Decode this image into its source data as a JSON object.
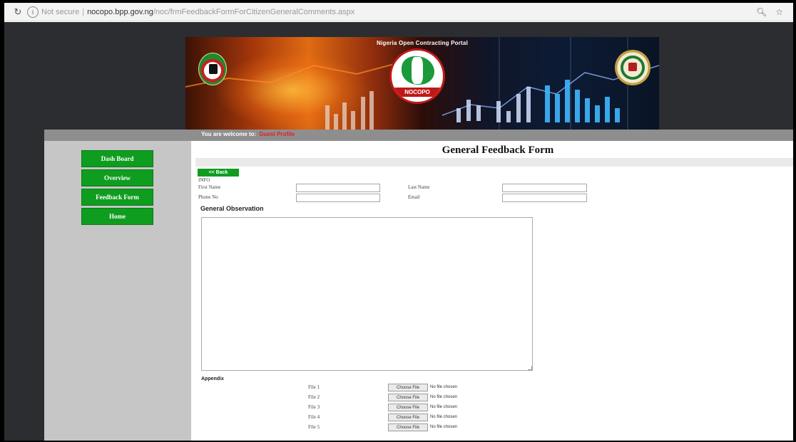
{
  "browser": {
    "security_label": "Not secure",
    "url_host": "nocopo.bpp.gov.ng",
    "url_path": "/noc/frmFeedbackFormForCitizenGeneralComments.aspx"
  },
  "banner": {
    "title": "Nigeria Open Contracting Portal",
    "logo_text": "NOCOPO"
  },
  "welcome": {
    "prefix": "You are welcome to:",
    "name": "Guest Profile"
  },
  "sidebar": {
    "items": [
      {
        "label": "Dash Board"
      },
      {
        "label": "Overview"
      },
      {
        "label": "Feedback Form"
      },
      {
        "label": "Home"
      }
    ]
  },
  "form": {
    "title": "General Feedback Form",
    "back_label": "<< Back",
    "info_label": "INFO",
    "first_name_label": "First Name",
    "last_name_label": "Last Name",
    "phone_label": "Phone No",
    "email_label": "Email",
    "first_name_value": "",
    "last_name_value": "",
    "phone_value": "",
    "email_value": "",
    "observation_heading": "General Observation",
    "observation_value": "",
    "appendix_heading": "Appendix",
    "choose_file_label": "Choose File",
    "no_file_label": "No file chosen",
    "files": [
      {
        "label": "File 1"
      },
      {
        "label": "File 2"
      },
      {
        "label": "File 3"
      },
      {
        "label": "File 4"
      },
      {
        "label": "File 5"
      }
    ]
  },
  "colors": {
    "accent_green": "#0f9d1f",
    "welcome_name_red": "#e61f1f",
    "page_background": "#2b2d31"
  }
}
